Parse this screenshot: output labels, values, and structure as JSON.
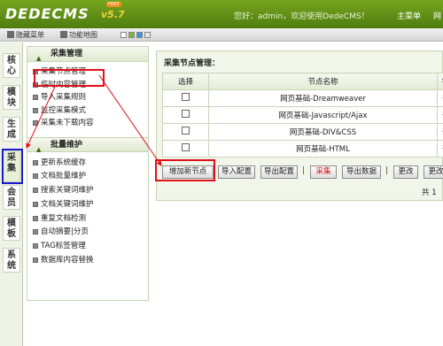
{
  "header": {
    "logo": "DEDECMS",
    "version": "v5.7",
    "badge": "FREE",
    "welcome": "您好：admin，欢迎使用DedeCMS！",
    "main_menu": "主菜单",
    "cms_link": "网"
  },
  "toolbar": {
    "hide_menu": "隐藏菜单",
    "feature_map": "功能地图",
    "swatches": [
      "#ffffff",
      "#80b63a",
      "#3d92d8",
      "#e6e6e6"
    ]
  },
  "lefttabs": [
    "核心",
    "模块",
    "生成",
    "采集",
    "会员",
    "模板",
    "系统"
  ],
  "menu": {
    "section1": "采集管理",
    "items1": [
      "采集节点管理",
      "临时内容管理",
      "导入采集规则",
      "监控采集模式",
      "采集未下载内容"
    ],
    "section2": "批量维护",
    "items2": [
      "更新系统缓存",
      "文档批量维护",
      "搜索关键词维护",
      "文档关键词维护",
      "重复文档检测",
      "自动摘要|分页",
      "TAG标签管理",
      "数据库内容替换"
    ]
  },
  "content": {
    "title": "采集节点管理：",
    "headers": [
      "选择",
      "节点名称",
      "针"
    ],
    "rows": [
      [
        "网页基础-Dreamweaver",
        "普"
      ],
      [
        "网页基础-Javascript/Ajax",
        "普"
      ],
      [
        "网页基础-DIV&CSS",
        "普"
      ],
      [
        "网页基础-HTML",
        "普"
      ]
    ],
    "buttons": {
      "add": "增加新节点",
      "import": "导入配置",
      "export": "导出配置",
      "collect": "采集",
      "export_data": "导出数据",
      "change1": "更改",
      "change2": "更改"
    },
    "pager": "共 1"
  },
  "colors": {
    "header_green": "#5f8f17",
    "highlight_red": "#e0101a",
    "highlight_blue": "#1a1ad4"
  }
}
